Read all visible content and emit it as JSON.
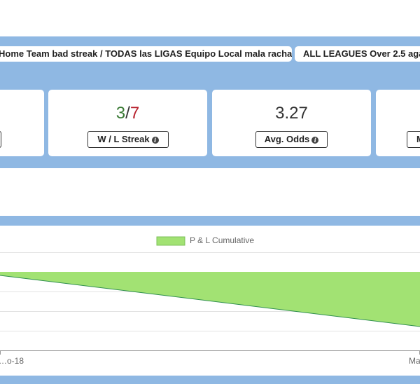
{
  "tabs": [
    {
      "label": "Home Team bad streak / TODAS las LIGAS Equipo Local mala racha"
    },
    {
      "label": "ALL LEAGUES Over 2.5 aga"
    }
  ],
  "stats": [
    {
      "button": ""
    },
    {
      "value_win": "3",
      "value_sep": "/",
      "value_loss": "7",
      "button": "W / L Streak"
    },
    {
      "value": "3.27",
      "button": "Avg. Odds"
    },
    {
      "button": "M"
    }
  ],
  "chart_data": {
    "type": "area",
    "legend": "P & L Cumulative",
    "x": [
      "…o-18",
      "Ma…"
    ],
    "series": [
      {
        "name": "P & L Cumulative",
        "fill": "#a2e273",
        "stroke": "#2f8f4e"
      }
    ],
    "grid": true
  },
  "colors": {
    "band": "#8fb8e3",
    "win": "#3a7a35",
    "loss": "#b8232f",
    "area_fill": "#a2e273",
    "area_stroke": "#2f8f4e"
  }
}
